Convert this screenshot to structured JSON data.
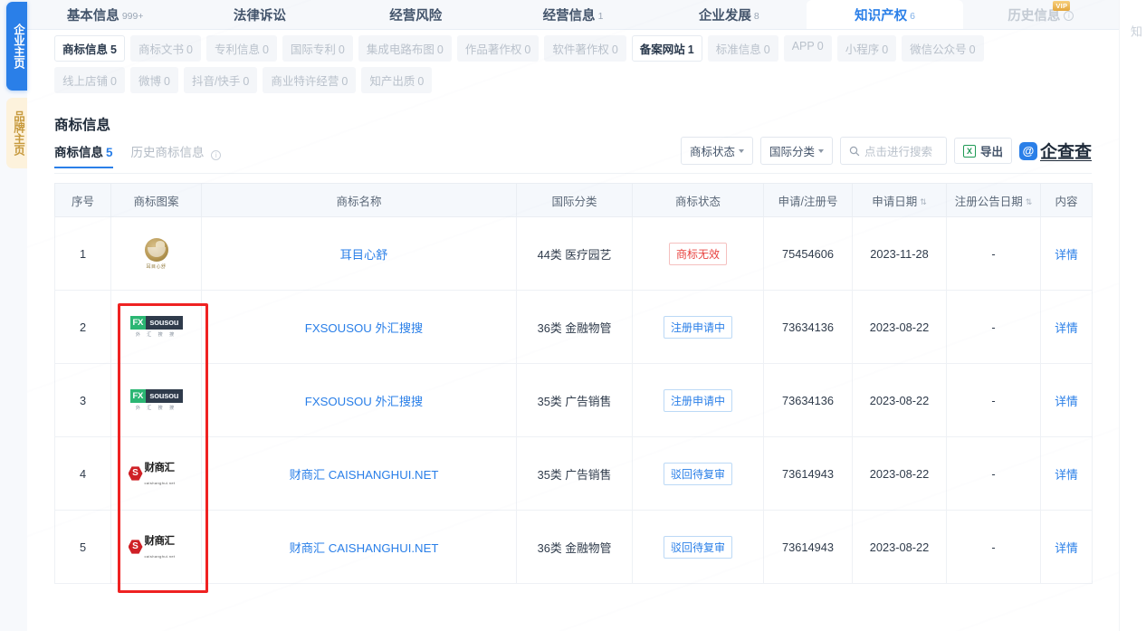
{
  "rail": {
    "tabs": [
      {
        "label": "企业主页",
        "active": true
      },
      {
        "label": "品牌主页",
        "active": false
      }
    ]
  },
  "main_tabs": [
    {
      "label": "基本信息",
      "count": "999+",
      "state": "normal"
    },
    {
      "label": "法律诉讼",
      "count": "",
      "state": "normal"
    },
    {
      "label": "经营风险",
      "count": "",
      "state": "normal"
    },
    {
      "label": "经营信息",
      "count": "1",
      "state": "normal"
    },
    {
      "label": "企业发展",
      "count": "8",
      "state": "normal"
    },
    {
      "label": "知识产权",
      "count": "6",
      "state": "active"
    },
    {
      "label": "历史信息",
      "count": "",
      "state": "muted",
      "badge": "VIP",
      "info_icon": true
    }
  ],
  "sub_tabs_row1": [
    {
      "label": "商标信息",
      "count": "5",
      "on": true
    },
    {
      "label": "商标文书",
      "count": "0",
      "on": false
    },
    {
      "label": "专利信息",
      "count": "0",
      "on": false
    },
    {
      "label": "国际专利",
      "count": "0",
      "on": false
    },
    {
      "label": "集成电路布图",
      "count": "0",
      "on": false
    },
    {
      "label": "作品著作权",
      "count": "0",
      "on": false
    },
    {
      "label": "软件著作权",
      "count": "0",
      "on": false
    },
    {
      "label": "备案网站",
      "count": "1",
      "on": true
    },
    {
      "label": "标准信息",
      "count": "0",
      "on": false
    },
    {
      "label": "APP",
      "count": "0",
      "on": false
    },
    {
      "label": "小程序",
      "count": "0",
      "on": false
    },
    {
      "label": "微信公众号",
      "count": "0",
      "on": false
    }
  ],
  "sub_tabs_row2": [
    {
      "label": "线上店铺",
      "count": "0",
      "on": false
    },
    {
      "label": "微博",
      "count": "0",
      "on": false
    },
    {
      "label": "抖音/快手",
      "count": "0",
      "on": false
    },
    {
      "label": "商业特许经营",
      "count": "0",
      "on": false
    },
    {
      "label": "知产出质",
      "count": "0",
      "on": false
    }
  ],
  "section": {
    "title": "商标信息",
    "inner_tabs": [
      {
        "label": "商标信息",
        "count": "5",
        "on": true,
        "info_icon": false
      },
      {
        "label": "历史商标信息",
        "count": "",
        "on": false,
        "info_icon": true
      }
    ]
  },
  "toolbar": {
    "status_filter": "商标状态",
    "class_filter": "国际分类",
    "search_placeholder": "点击进行搜索",
    "export_label": "导出",
    "export_icon": "xls-icon",
    "brand_name": "企查查",
    "brand_color": "#2a7fe8"
  },
  "table": {
    "columns": [
      {
        "key": "index",
        "label": "序号",
        "sortable": false
      },
      {
        "key": "logo",
        "label": "商标图案",
        "sortable": false
      },
      {
        "key": "name",
        "label": "商标名称",
        "sortable": false
      },
      {
        "key": "intl_class",
        "label": "国际分类",
        "sortable": false
      },
      {
        "key": "status",
        "label": "商标状态",
        "sortable": false
      },
      {
        "key": "reg_no",
        "label": "申请/注册号",
        "sortable": false
      },
      {
        "key": "apply_date",
        "label": "申请日期",
        "sortable": true
      },
      {
        "key": "announce_date",
        "label": "注册公告日期",
        "sortable": true
      },
      {
        "key": "content",
        "label": "内容",
        "sortable": false
      }
    ],
    "rows": [
      {
        "index": "1",
        "logo": "ermuxinshu-logo",
        "logo_sub": "耳目心舒",
        "name": "耳目心舒",
        "intl_class": "44类 医疗园艺",
        "status": "商标无效",
        "status_type": "invalid",
        "reg_no": "75454606",
        "apply_date": "2023-11-28",
        "announce_date": "-",
        "content": "详情"
      },
      {
        "index": "2",
        "logo": "fxsousou-logo",
        "logo_main": "FX",
        "logo_alt": "sousou",
        "logo_sub": "外 汇 搜 搜",
        "name": "FXSOUSOU 外汇搜搜",
        "intl_class": "36类 金融物管",
        "status": "注册申请中",
        "status_type": "pending",
        "reg_no": "73634136",
        "apply_date": "2023-08-22",
        "announce_date": "-",
        "content": "详情"
      },
      {
        "index": "3",
        "logo": "fxsousou-logo",
        "logo_main": "FX",
        "logo_alt": "sousou",
        "logo_sub": "外 汇 搜 搜",
        "name": "FXSOUSOU 外汇搜搜",
        "intl_class": "35类 广告销售",
        "status": "注册申请中",
        "status_type": "pending",
        "reg_no": "73634136",
        "apply_date": "2023-08-22",
        "announce_date": "-",
        "content": "详情"
      },
      {
        "index": "4",
        "logo": "caishanghui-logo",
        "logo_main": "财商汇",
        "logo_sub": "caishanghui.net",
        "name": "财商汇 CAISHANGHUI.NET",
        "intl_class": "35类 广告销售",
        "status": "驳回待复审",
        "status_type": "rejected",
        "reg_no": "73614943",
        "apply_date": "2023-08-22",
        "announce_date": "-",
        "content": "详情"
      },
      {
        "index": "5",
        "logo": "caishanghui-logo",
        "logo_main": "财商汇",
        "logo_sub": "caishanghui.net",
        "name": "财商汇 CAISHANGHUI.NET",
        "intl_class": "36类 金融物管",
        "status": "驳回待复审",
        "status_type": "rejected",
        "reg_no": "73614943",
        "apply_date": "2023-08-22",
        "announce_date": "-",
        "content": "详情"
      }
    ]
  },
  "annotation": {
    "color": "#ef2222",
    "target": "商标图案"
  },
  "right_edge": {
    "partial_text": "知"
  }
}
